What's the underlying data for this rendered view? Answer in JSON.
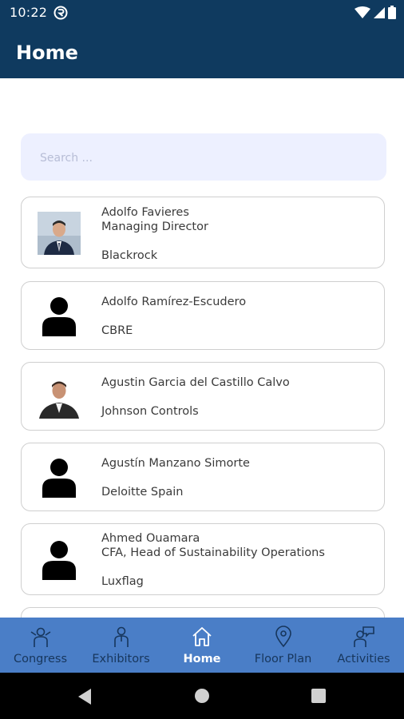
{
  "status": {
    "time": "10:22"
  },
  "appbar": {
    "title": "Home"
  },
  "search": {
    "placeholder": "Search ..."
  },
  "contacts": [
    {
      "name": "Adolfo Favieres",
      "role": "Managing Director",
      "company": "Blackrock",
      "avatar": "photo"
    },
    {
      "name": "Adolfo Ramírez-Escudero",
      "role": "",
      "company": "CBRE",
      "avatar": "person-icon"
    },
    {
      "name": "Agustin Garcia del Castillo Calvo",
      "role": "",
      "company": "Johnson Controls",
      "avatar": "photo"
    },
    {
      "name": "Agustín Manzano Simorte",
      "role": "",
      "company": "Deloitte Spain",
      "avatar": "person-icon"
    },
    {
      "name": "Ahmed Ouamara",
      "role": "CFA, Head of Sustainability Operations",
      "company": "Luxflag",
      "avatar": "person-icon"
    }
  ],
  "nav": {
    "items": [
      {
        "label": "Congress",
        "icon": "congress-icon"
      },
      {
        "label": "Exhibitors",
        "icon": "exhibitors-icon"
      },
      {
        "label": "Home",
        "icon": "home-icon",
        "active": true
      },
      {
        "label": "Floor Plan",
        "icon": "location-pin-icon"
      },
      {
        "label": "Activities",
        "icon": "chat-person-icon"
      }
    ]
  },
  "colors": {
    "appbar": "#0f3a5f",
    "bottom_nav": "#4a7ec7",
    "search_bg": "#edf0ff"
  }
}
